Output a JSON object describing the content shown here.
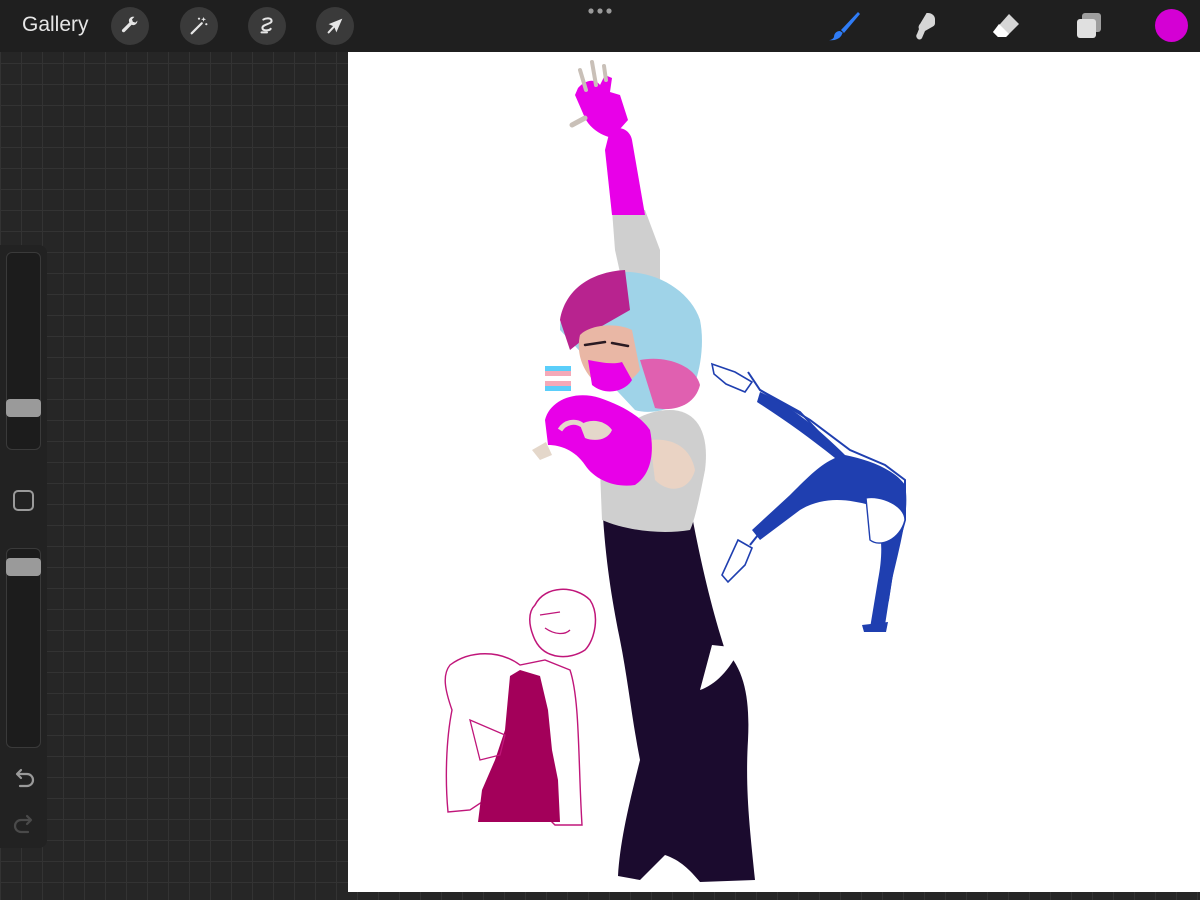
{
  "app": {
    "gallery_label": "Gallery"
  },
  "toolbar_left": {
    "icons": [
      "wrench-icon",
      "magic-wand-icon",
      "selection-icon",
      "transform-arrow-icon"
    ]
  },
  "toolbar_right": {
    "icons": [
      "brush-icon",
      "smudge-icon",
      "eraser-icon",
      "layers-icon"
    ],
    "active_tool": "brush",
    "current_color": "#d400d4",
    "brush_active_color": "#2f7cf6"
  },
  "sidebar": {
    "brush_size_level": 0.17,
    "opacity_level": 0.96,
    "icons": [
      "modifier-square-icon",
      "undo-icon",
      "redo-icon"
    ]
  },
  "canvas": {
    "background": "#ffffff"
  }
}
